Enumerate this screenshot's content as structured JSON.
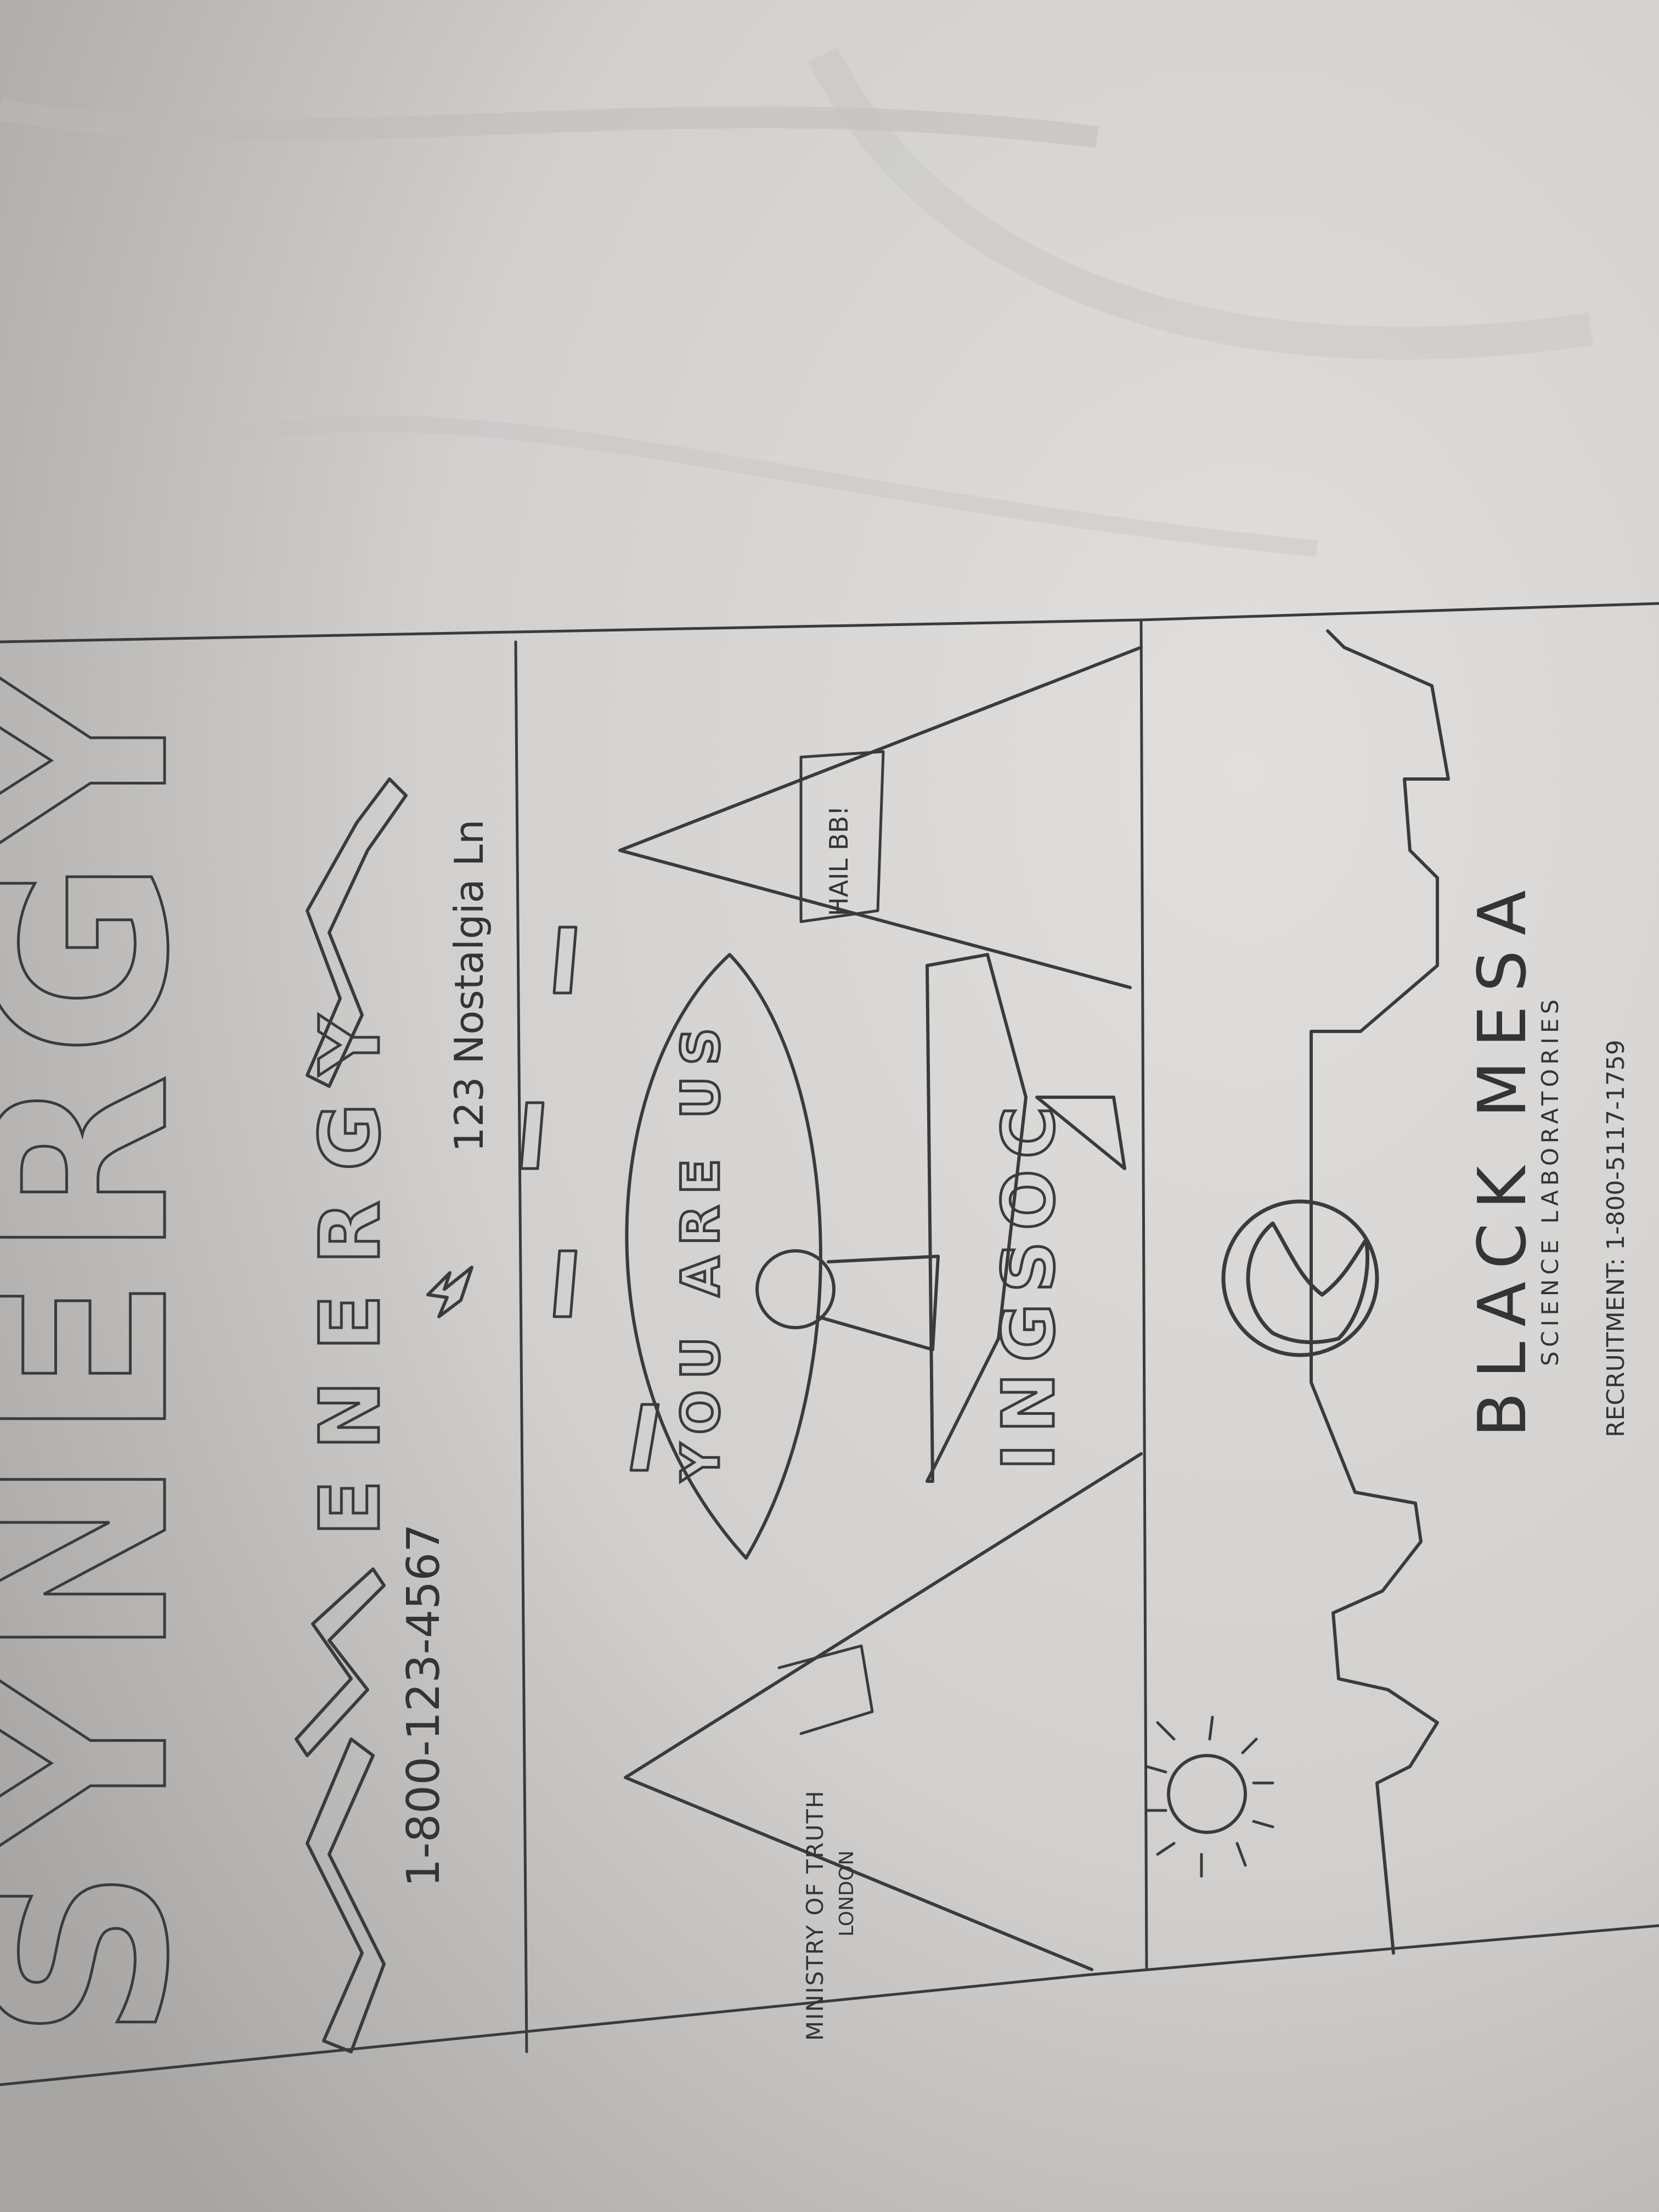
{
  "photo": {
    "subject": "pencil sketch of three signs on crumpled paper, photographed sideways",
    "colors": {
      "paper_light": "#dcdad8",
      "paper_shadow": "#a9a7a5",
      "pencil": "#3b3b3b"
    }
  },
  "panel_synergy": {
    "logo": "SYNERGY",
    "tagline": "ENERGY",
    "phone": "1-800-123-4567",
    "address": "123 Nostalgia Ln",
    "bolt_icon": "lightning-bolt-icon"
  },
  "panel_ingsoc": {
    "ministry_line1": "MINISTRY OF TRUTH",
    "ministry_line2": "LONDON",
    "eye_text": "YOU ARE US",
    "party_name": "INGSOC",
    "pyramid_banner": "HAIL BB!",
    "sun_icon": "sun-icon"
  },
  "panel_blackmesa": {
    "title": "BLACK MESA",
    "subtitle": "SCIENCE LABORATORIES",
    "recruitment": "RECRUITMENT: 1-800-5117-1759",
    "logo_icon": "black-mesa-logo-icon"
  }
}
